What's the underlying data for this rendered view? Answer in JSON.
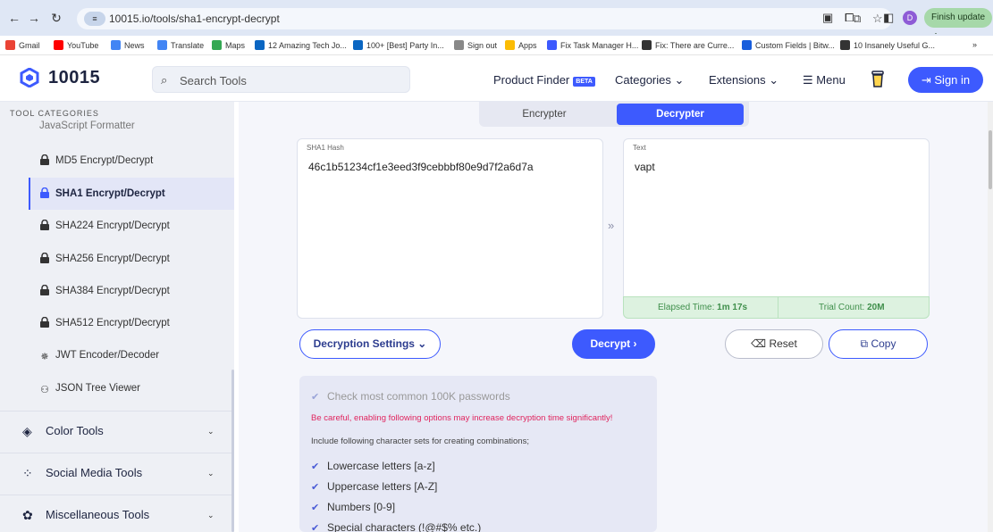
{
  "browser": {
    "url": "10015.io/tools/sha1-encrypt-decrypt",
    "profile_initial": "D",
    "finish_update": "Finish update",
    "bookmarks": [
      {
        "label": "Gmail",
        "color": "#ea4335"
      },
      {
        "label": "YouTube",
        "color": "#ff0000"
      },
      {
        "label": "News",
        "color": "#4285f4"
      },
      {
        "label": "Translate",
        "color": "#4285f4"
      },
      {
        "label": "Maps",
        "color": "#34a853"
      },
      {
        "label": "12 Amazing Tech Jo...",
        "color": "#0a66c2"
      },
      {
        "label": "100+ [Best] Party In...",
        "color": "#0a66c2"
      },
      {
        "label": "Sign out",
        "color": "#888888"
      },
      {
        "label": "Apps",
        "color": "#fbbc05"
      },
      {
        "label": "Fix Task Manager H...",
        "color": "#3d5afe"
      },
      {
        "label": "Fix: There are Curre...",
        "color": "#333333"
      },
      {
        "label": "Custom Fields | Bitw...",
        "color": "#175ddc"
      },
      {
        "label": "10 Insanely Useful G...",
        "color": "#333333"
      }
    ],
    "more": "»"
  },
  "header": {
    "logo": "10015",
    "search_placeholder": "Search Tools",
    "product_finder": "Product Finder",
    "beta": "BETA",
    "categories": "Categories ⌄",
    "extensions": "Extensions ⌄",
    "menu": "Menu",
    "sign_in": "Sign in"
  },
  "sidebar": {
    "heading": "TOOL CATEGORIES",
    "partial_item": "JavaScript Formatter",
    "items": [
      {
        "label": "MD5 Encrypt/Decrypt",
        "badge": "MD5"
      },
      {
        "label": "SHA1 Encrypt/Decrypt",
        "badge": "SHA1"
      },
      {
        "label": "SHA224 Encrypt/Decrypt",
        "badge": "224"
      },
      {
        "label": "SHA256 Encrypt/Decrypt",
        "badge": "256"
      },
      {
        "label": "SHA384 Encrypt/Decrypt",
        "badge": "384"
      },
      {
        "label": "SHA512 Encrypt/Decrypt",
        "badge": "512"
      },
      {
        "label": "JWT Encoder/Decoder",
        "badge": "JWT"
      },
      {
        "label": "JSON Tree Viewer",
        "badge": "JSON"
      }
    ],
    "groups": [
      {
        "label": "Color Tools"
      },
      {
        "label": "Social Media Tools"
      },
      {
        "label": "Miscellaneous Tools"
      }
    ]
  },
  "main": {
    "tabs": {
      "encrypter": "Encrypter",
      "decrypter": "Decrypter"
    },
    "hash_label": "SHA1 Hash",
    "hash_value": "46c1b51234cf1e3eed3f9cebbbf80e9d7f2a6d7a",
    "text_label": "Text",
    "text_value": "vapt",
    "arrow": "»",
    "elapsed_label": "Elapsed Time: ",
    "elapsed_value": "1m 17s",
    "trial_label": "Trial Count: ",
    "trial_value": "20M",
    "decryption_settings": "Decryption Settings ⌄",
    "decrypt": "Decrypt ›",
    "reset": "Reset",
    "copy": "Copy",
    "settings": {
      "common": "Check most common 100K passwords",
      "warning": "Be careful, enabling following options may increase decryption time significantly!",
      "include": "Include following character sets for creating combinations;",
      "lowercase": "Lowercase letters [a-z]",
      "uppercase": "Uppercase letters [A-Z]",
      "numbers": "Numbers [0-9]",
      "special": "Special characters (!@#$% etc.)"
    }
  }
}
